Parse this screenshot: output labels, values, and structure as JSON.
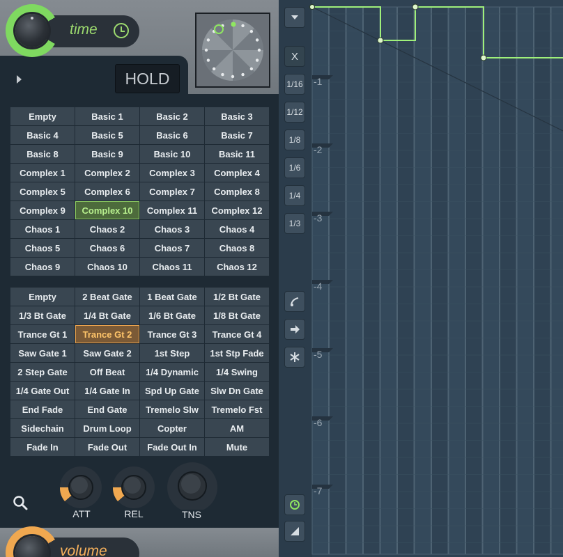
{
  "time_section": {
    "label": "time",
    "icon": "clock-icon",
    "accent": "#7fd960"
  },
  "hold_button": {
    "label": "HOLD"
  },
  "preset_grid_top": {
    "selected": "Complex 10",
    "items": [
      "Empty",
      "Basic 1",
      "Basic 2",
      "Basic 3",
      "Basic 4",
      "Basic 5",
      "Basic 6",
      "Basic 7",
      "Basic 8",
      "Basic 9",
      "Basic 10",
      "Basic 11",
      "Complex 1",
      "Complex 2",
      "Complex 3",
      "Complex 4",
      "Complex 5",
      "Complex 6",
      "Complex 7",
      "Complex 8",
      "Complex 9",
      "Complex 10",
      "Complex 11",
      "Complex 12",
      "Chaos 1",
      "Chaos 2",
      "Chaos 3",
      "Chaos 4",
      "Chaos 5",
      "Chaos 6",
      "Chaos 7",
      "Chaos 8",
      "Chaos 9",
      "Chaos 10",
      "Chaos 11",
      "Chaos 12"
    ]
  },
  "preset_grid_bottom": {
    "selected": "Trance Gt 2",
    "items": [
      "Empty",
      "2 Beat Gate",
      "1 Beat Gate",
      "1/2 Bt Gate",
      "1/3 Bt Gate",
      "1/4 Bt Gate",
      "1/6 Bt Gate",
      "1/8 Bt Gate",
      "Trance Gt 1",
      "Trance Gt 2",
      "Trance Gt 3",
      "Trance Gt 4",
      "Saw Gate 1",
      "Saw Gate 2",
      "1st Step",
      "1st Stp Fade",
      "2 Step Gate",
      "Off Beat",
      "1/4 Dynamic",
      "1/4 Swing",
      "1/4 Gate Out",
      "1/4 Gate In",
      "Spd Up Gate",
      "Slw Dn Gate",
      "End Fade",
      "End Gate",
      "Tremelo Slw",
      "Tremelo Fst",
      "Sidechain",
      "Drum Loop",
      "Copter",
      "AM",
      "Fade In",
      "Fade Out",
      "Fade Out In",
      "Mute"
    ]
  },
  "knobs": [
    {
      "label": "ATT",
      "value": 0.15
    },
    {
      "label": "REL",
      "value": 0.15
    },
    {
      "label": "TNS",
      "value": 0.5
    }
  ],
  "volume_section": {
    "label": "volume",
    "accent": "#f0a850"
  },
  "side_buttons": {
    "close": "X",
    "snaps": [
      "1/16",
      "1/12",
      "1/8",
      "1/6",
      "1/4",
      "1/3"
    ]
  },
  "envelope": {
    "ruler_labels": [
      "-1",
      "-2",
      "-3",
      "-4",
      "-5",
      "-6",
      "-7"
    ],
    "line_color": "#9ff07a"
  }
}
